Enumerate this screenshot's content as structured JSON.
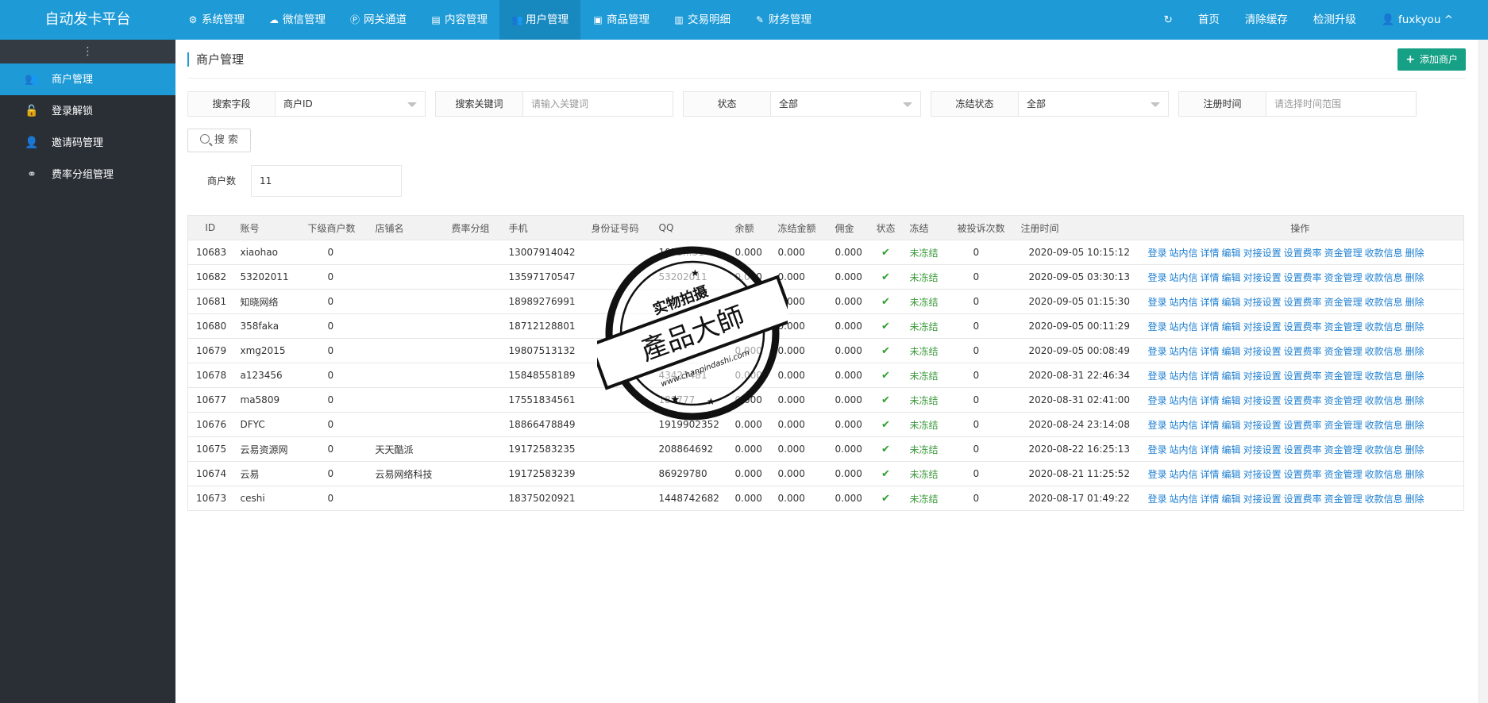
{
  "brand": "自动发卡平台",
  "topnav": [
    {
      "label": "系统管理",
      "icon": "gear-icon",
      "glyph": "⚙"
    },
    {
      "label": "微信管理",
      "icon": "wechat-icon",
      "glyph": "☁"
    },
    {
      "label": "网关通道",
      "icon": "gateway-icon",
      "glyph": "Ⓟ"
    },
    {
      "label": "内容管理",
      "icon": "document-icon",
      "glyph": "▤"
    },
    {
      "label": "用户管理",
      "icon": "users-icon",
      "glyph": "👥"
    },
    {
      "label": "商品管理",
      "icon": "shopping-bag-icon",
      "glyph": "▣"
    },
    {
      "label": "交易明细",
      "icon": "bar-chart-icon",
      "glyph": "▥"
    },
    {
      "label": "财务管理",
      "icon": "money-icon",
      "glyph": "✎"
    }
  ],
  "topright": {
    "refresh_icon": "refresh-icon",
    "refresh_glyph": "↻",
    "home": "首页",
    "clear_cache": "清除缓存",
    "check_update": "检测升级",
    "user": "fuxkyou",
    "user_glyph": "👤",
    "caret": "^"
  },
  "sidebar": {
    "toggle": "⋮",
    "items": [
      {
        "label": "商户管理",
        "icon": "users-icon",
        "glyph": "👥"
      },
      {
        "label": "登录解锁",
        "icon": "unlock-icon",
        "glyph": "🔓"
      },
      {
        "label": "邀请码管理",
        "icon": "user-add-icon",
        "glyph": "👤"
      },
      {
        "label": "费率分组管理",
        "icon": "link-icon",
        "glyph": "⚭"
      }
    ]
  },
  "page": {
    "title": "商户管理",
    "add_button": "添加商户",
    "add_plus": "+"
  },
  "filters": {
    "field": {
      "label": "搜索字段",
      "value": "商户ID"
    },
    "keyword": {
      "label": "搜索关键词",
      "placeholder": "请输入关键词"
    },
    "status": {
      "label": "状态",
      "value": "全部"
    },
    "frozen": {
      "label": "冻结状态",
      "value": "全部"
    },
    "regtime": {
      "label": "注册时间",
      "placeholder": "请选择时间范围"
    },
    "search_button": "搜 索"
  },
  "count": {
    "label": "商户数",
    "value": "11"
  },
  "table": {
    "headers": [
      "ID",
      "账号",
      "下级商户数",
      "店铺名",
      "费率分组",
      "手机",
      "身份证号码",
      "QQ",
      "余额",
      "冻结金额",
      "佣金",
      "状态",
      "冻结",
      "被投诉次数",
      "注册时间",
      "操作"
    ],
    "actions": [
      "登录",
      "站内信",
      "详情",
      "编辑",
      "对接设置",
      "设置费率",
      "资金管理",
      "收款信息",
      "删除"
    ],
    "status_icon": "check-icon",
    "status_glyph": "✔",
    "rows": [
      {
        "id": "10683",
        "account": "xiaohao",
        "subs": "0",
        "shop": "",
        "group": "",
        "phone": "13007914042",
        "idcard": "",
        "qq": "1055...31",
        "balance": "0.000",
        "frozen_amt": "0.000",
        "commission": "0.000",
        "frozen": "未冻结",
        "complaints": "0",
        "regtime": "2020-09-05 10:15:12"
      },
      {
        "id": "10682",
        "account": "53202011",
        "subs": "0",
        "shop": "",
        "group": "",
        "phone": "13597170547",
        "idcard": "",
        "qq": "53202011",
        "balance": "0.000",
        "frozen_amt": "0.000",
        "commission": "0.000",
        "frozen": "未冻结",
        "complaints": "0",
        "regtime": "2020-09-05 03:30:13"
      },
      {
        "id": "10681",
        "account": "知晓网络",
        "subs": "0",
        "shop": "",
        "group": "",
        "phone": "18989276991",
        "idcard": "",
        "qq": "",
        "balance": "0.000",
        "frozen_amt": "0.000",
        "commission": "0.000",
        "frozen": "未冻结",
        "complaints": "0",
        "regtime": "2020-09-05 01:15:30"
      },
      {
        "id": "10680",
        "account": "358faka",
        "subs": "0",
        "shop": "",
        "group": "",
        "phone": "18712128801",
        "idcard": "",
        "qq": "",
        "balance": "0.000",
        "frozen_amt": "0.000",
        "commission": "0.000",
        "frozen": "未冻结",
        "complaints": "0",
        "regtime": "2020-09-05 00:11:29"
      },
      {
        "id": "10679",
        "account": "xmg2015",
        "subs": "0",
        "shop": "",
        "group": "",
        "phone": "19807513132",
        "idcard": "",
        "qq": "",
        "balance": "0.000",
        "frozen_amt": "0.000",
        "commission": "0.000",
        "frozen": "未冻结",
        "complaints": "0",
        "regtime": "2020-09-05 00:08:49"
      },
      {
        "id": "10678",
        "account": "a123456",
        "subs": "0",
        "shop": "",
        "group": "",
        "phone": "15848558189",
        "idcard": "",
        "qq": "43423481",
        "balance": "0.000",
        "frozen_amt": "0.000",
        "commission": "0.000",
        "frozen": "未冻结",
        "complaints": "0",
        "regtime": "2020-08-31 22:46:34"
      },
      {
        "id": "10677",
        "account": "ma5809",
        "subs": "0",
        "shop": "",
        "group": "",
        "phone": "17551834561",
        "idcard": "",
        "qq": "181777",
        "balance": "0.000",
        "frozen_amt": "0.000",
        "commission": "0.000",
        "frozen": "未冻结",
        "complaints": "0",
        "regtime": "2020-08-31 02:41:00"
      },
      {
        "id": "10676",
        "account": "DFYC",
        "subs": "0",
        "shop": "",
        "group": "",
        "phone": "18866478849",
        "idcard": "",
        "qq": "1919902352",
        "balance": "0.000",
        "frozen_amt": "0.000",
        "commission": "0.000",
        "frozen": "未冻结",
        "complaints": "0",
        "regtime": "2020-08-24 23:14:08"
      },
      {
        "id": "10675",
        "account": "云易资源网",
        "subs": "0",
        "shop": "天天酷派",
        "group": "",
        "phone": "19172583235",
        "idcard": "",
        "qq": "208864692",
        "balance": "0.000",
        "frozen_amt": "0.000",
        "commission": "0.000",
        "frozen": "未冻结",
        "complaints": "0",
        "regtime": "2020-08-22 16:25:13"
      },
      {
        "id": "10674",
        "account": "云易",
        "subs": "0",
        "shop": "云易网络科技",
        "group": "",
        "phone": "19172583239",
        "idcard": "",
        "qq": "86929780",
        "balance": "0.000",
        "frozen_amt": "0.000",
        "commission": "0.000",
        "frozen": "未冻结",
        "complaints": "0",
        "regtime": "2020-08-21 11:25:52"
      },
      {
        "id": "10673",
        "account": "ceshi",
        "subs": "0",
        "shop": "",
        "group": "",
        "phone": "18375020921",
        "idcard": "",
        "qq": "1448742682",
        "balance": "0.000",
        "frozen_amt": "0.000",
        "commission": "0.000",
        "frozen": "未冻结",
        "complaints": "0",
        "regtime": "2020-08-17 01:49:22"
      }
    ]
  },
  "watermark": {
    "line1": "实物拍摄",
    "line2": "產品大師",
    "line3": "www.chanpindashi.com"
  }
}
